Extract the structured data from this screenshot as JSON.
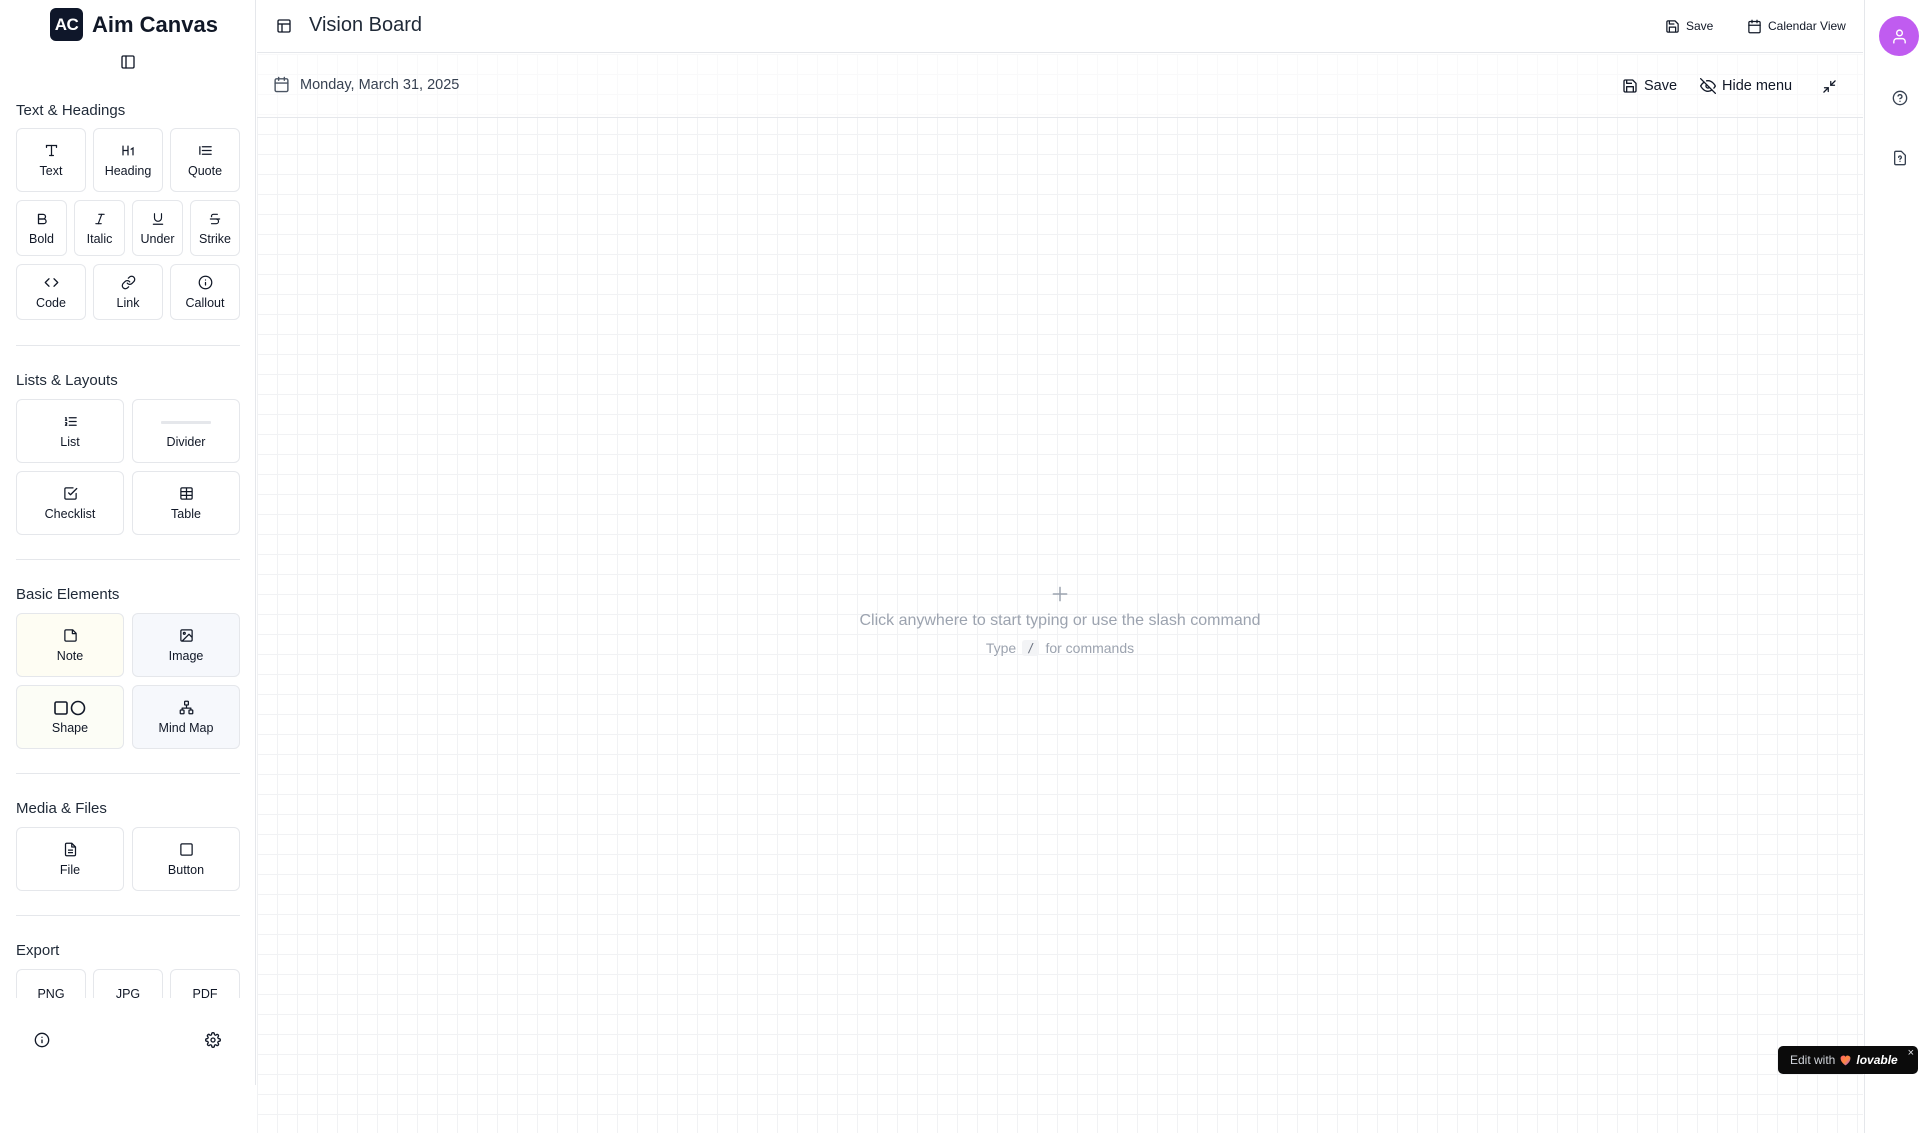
{
  "brand": {
    "logo": "AC",
    "name": "Aim Canvas"
  },
  "sidebar": {
    "sections": {
      "text": {
        "title": "Text & Headings",
        "items": [
          "Text",
          "Heading",
          "Quote",
          "Bold",
          "Italic",
          "Under",
          "Strike",
          "Code",
          "Link",
          "Callout"
        ]
      },
      "lists": {
        "title": "Lists & Layouts",
        "items": [
          "List",
          "Divider",
          "Checklist",
          "Table"
        ]
      },
      "basic": {
        "title": "Basic Elements",
        "items": [
          "Note",
          "Image",
          "Shape",
          "Mind Map"
        ]
      },
      "media": {
        "title": "Media & Files",
        "items": [
          "File",
          "Button"
        ]
      },
      "export": {
        "title": "Export",
        "items": [
          "PNG",
          "JPG",
          "PDF"
        ]
      }
    }
  },
  "header": {
    "title": "Vision Board",
    "save_label": "Save",
    "calendar_label": "Calendar View"
  },
  "canvas": {
    "date": "Monday, March 31, 2025",
    "save_label": "Save",
    "hide_menu_label": "Hide menu",
    "empty_main": "Click anywhere to start typing or use the slash command",
    "empty_sub_prefix": "Type",
    "empty_sub_key": "/",
    "empty_sub_suffix": "for commands"
  },
  "badge": {
    "text": "Edit with",
    "brand": "lovable",
    "close": "×"
  },
  "colors": {
    "avatar": "#c05cf0",
    "logo_bg": "#0f172a",
    "note_tint": "#fefdf3",
    "image_tint": "#f6f8fc"
  },
  "icons": {
    "sidebar_toggle": "panel-left-icon",
    "info": "info-icon",
    "settings": "gear-icon",
    "layout": "layout-icon",
    "save": "save-icon",
    "calendar": "calendar-icon",
    "hide": "eye-off-icon",
    "collapse": "minimize-icon",
    "user": "user-icon",
    "help": "help-circle-icon",
    "doc_help": "file-question-icon"
  }
}
